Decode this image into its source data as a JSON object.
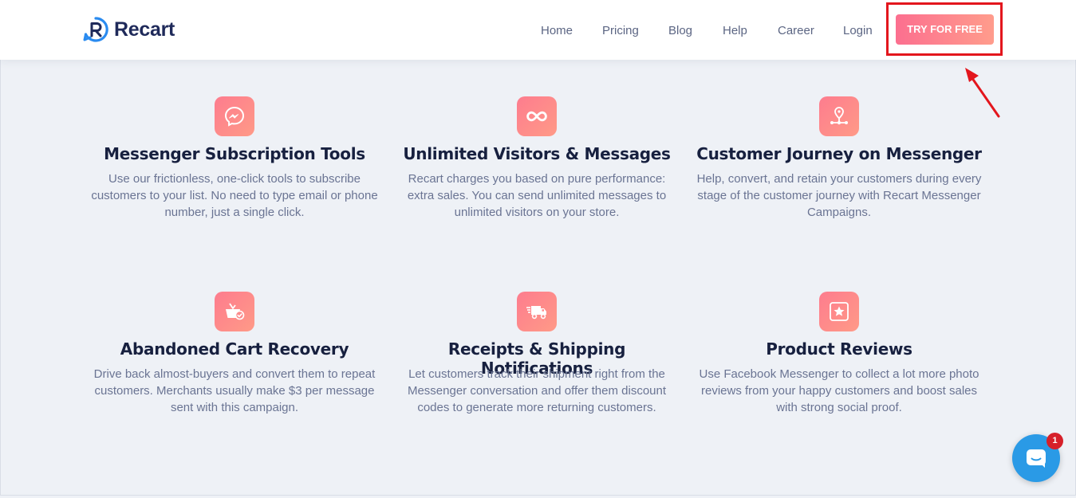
{
  "brand": {
    "name": "Recart"
  },
  "nav": {
    "items": [
      {
        "label": "Home"
      },
      {
        "label": "Pricing"
      },
      {
        "label": "Blog"
      },
      {
        "label": "Help"
      },
      {
        "label": "Career"
      },
      {
        "label": "Login"
      }
    ],
    "cta_label": "TRY FOR FREE"
  },
  "features": [
    {
      "icon": "messenger-icon",
      "title": "Messenger Subscription Tools",
      "description": "Use our frictionless, one-click tools to subscribe customers to your list. No need to type email or phone number, just a single click."
    },
    {
      "icon": "infinity-icon",
      "title": "Unlimited Visitors & Messages",
      "description": "Recart charges you based on pure performance: extra sales. You can send unlimited messages to unlimited visitors on your store."
    },
    {
      "icon": "journey-map-pin-icon",
      "title": "Customer Journey on Messenger",
      "description": "Help, convert, and retain your customers during every stage of the customer journey with Recart Messenger Campaigns."
    },
    {
      "icon": "basket-check-icon",
      "title": "Abandoned Cart Recovery",
      "description": "Drive back almost-buyers and convert them to repeat customers. Merchants usually make $3 per message sent with this campaign."
    },
    {
      "icon": "delivery-truck-icon",
      "title": "Receipts & Shipping Notifications",
      "description": "Let customers track their shipment right from the Messenger conversation and offer them discount codes to generate more returning customers."
    },
    {
      "icon": "star-icon",
      "title": "Product Reviews",
      "description": "Use Facebook Messenger to collect a lot more photo reviews from your happy customers and boost sales with strong social proof."
    }
  ],
  "chat_widget": {
    "badge_count": "1"
  },
  "colors": {
    "accent_gradient_start": "#fc6f8f",
    "accent_gradient_end": "#ff9c8c",
    "highlight_box": "#e3161d",
    "chat_button": "#2a9ae6",
    "background": "#eef1f6"
  }
}
